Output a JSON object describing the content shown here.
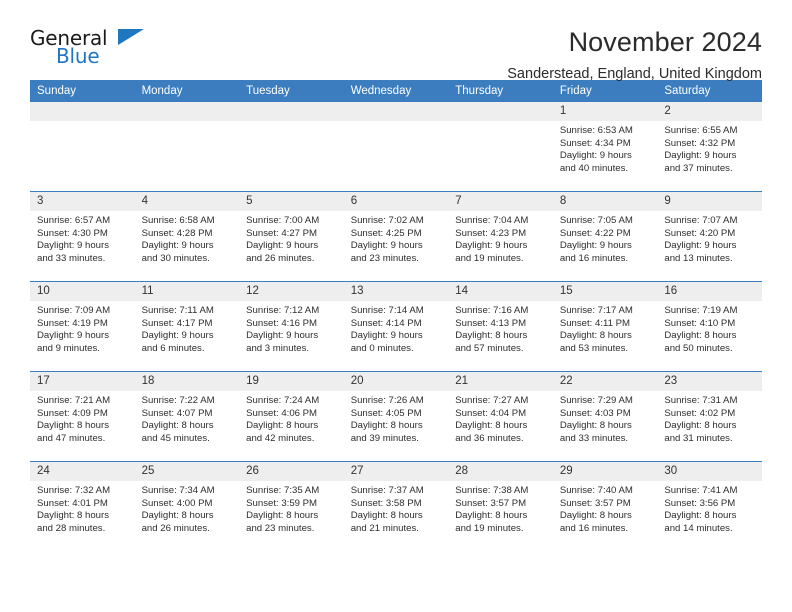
{
  "brand": {
    "name_top": "General",
    "name_bottom": "Blue",
    "accent_color": "#1f77c0"
  },
  "header": {
    "title": "November 2024",
    "location": "Sanderstead, England, United Kingdom"
  },
  "theme": {
    "header_row_color": "#3b7dbf",
    "daynum_bg": "#eeeeee",
    "text_color": "#2e2e2e"
  },
  "labels": {
    "sunrise_prefix": "Sunrise:",
    "sunset_prefix": "Sunset:",
    "daylight_prefix": "Daylight:"
  },
  "columns": [
    "Sunday",
    "Monday",
    "Tuesday",
    "Wednesday",
    "Thursday",
    "Friday",
    "Saturday"
  ],
  "weeks": [
    [
      {
        "day": "",
        "empty": true
      },
      {
        "day": "",
        "empty": true
      },
      {
        "day": "",
        "empty": true
      },
      {
        "day": "",
        "empty": true
      },
      {
        "day": "",
        "empty": true
      },
      {
        "day": "1",
        "sunrise": "Sunrise: 6:53 AM",
        "sunset": "Sunset: 4:34 PM",
        "daylight_1": "Daylight: 9 hours",
        "daylight_2": "and 40 minutes."
      },
      {
        "day": "2",
        "sunrise": "Sunrise: 6:55 AM",
        "sunset": "Sunset: 4:32 PM",
        "daylight_1": "Daylight: 9 hours",
        "daylight_2": "and 37 minutes."
      }
    ],
    [
      {
        "day": "3",
        "sunrise": "Sunrise: 6:57 AM",
        "sunset": "Sunset: 4:30 PM",
        "daylight_1": "Daylight: 9 hours",
        "daylight_2": "and 33 minutes."
      },
      {
        "day": "4",
        "sunrise": "Sunrise: 6:58 AM",
        "sunset": "Sunset: 4:28 PM",
        "daylight_1": "Daylight: 9 hours",
        "daylight_2": "and 30 minutes."
      },
      {
        "day": "5",
        "sunrise": "Sunrise: 7:00 AM",
        "sunset": "Sunset: 4:27 PM",
        "daylight_1": "Daylight: 9 hours",
        "daylight_2": "and 26 minutes."
      },
      {
        "day": "6",
        "sunrise": "Sunrise: 7:02 AM",
        "sunset": "Sunset: 4:25 PM",
        "daylight_1": "Daylight: 9 hours",
        "daylight_2": "and 23 minutes."
      },
      {
        "day": "7",
        "sunrise": "Sunrise: 7:04 AM",
        "sunset": "Sunset: 4:23 PM",
        "daylight_1": "Daylight: 9 hours",
        "daylight_2": "and 19 minutes."
      },
      {
        "day": "8",
        "sunrise": "Sunrise: 7:05 AM",
        "sunset": "Sunset: 4:22 PM",
        "daylight_1": "Daylight: 9 hours",
        "daylight_2": "and 16 minutes."
      },
      {
        "day": "9",
        "sunrise": "Sunrise: 7:07 AM",
        "sunset": "Sunset: 4:20 PM",
        "daylight_1": "Daylight: 9 hours",
        "daylight_2": "and 13 minutes."
      }
    ],
    [
      {
        "day": "10",
        "sunrise": "Sunrise: 7:09 AM",
        "sunset": "Sunset: 4:19 PM",
        "daylight_1": "Daylight: 9 hours",
        "daylight_2": "and 9 minutes."
      },
      {
        "day": "11",
        "sunrise": "Sunrise: 7:11 AM",
        "sunset": "Sunset: 4:17 PM",
        "daylight_1": "Daylight: 9 hours",
        "daylight_2": "and 6 minutes."
      },
      {
        "day": "12",
        "sunrise": "Sunrise: 7:12 AM",
        "sunset": "Sunset: 4:16 PM",
        "daylight_1": "Daylight: 9 hours",
        "daylight_2": "and 3 minutes."
      },
      {
        "day": "13",
        "sunrise": "Sunrise: 7:14 AM",
        "sunset": "Sunset: 4:14 PM",
        "daylight_1": "Daylight: 9 hours",
        "daylight_2": "and 0 minutes."
      },
      {
        "day": "14",
        "sunrise": "Sunrise: 7:16 AM",
        "sunset": "Sunset: 4:13 PM",
        "daylight_1": "Daylight: 8 hours",
        "daylight_2": "and 57 minutes."
      },
      {
        "day": "15",
        "sunrise": "Sunrise: 7:17 AM",
        "sunset": "Sunset: 4:11 PM",
        "daylight_1": "Daylight: 8 hours",
        "daylight_2": "and 53 minutes."
      },
      {
        "day": "16",
        "sunrise": "Sunrise: 7:19 AM",
        "sunset": "Sunset: 4:10 PM",
        "daylight_1": "Daylight: 8 hours",
        "daylight_2": "and 50 minutes."
      }
    ],
    [
      {
        "day": "17",
        "sunrise": "Sunrise: 7:21 AM",
        "sunset": "Sunset: 4:09 PM",
        "daylight_1": "Daylight: 8 hours",
        "daylight_2": "and 47 minutes."
      },
      {
        "day": "18",
        "sunrise": "Sunrise: 7:22 AM",
        "sunset": "Sunset: 4:07 PM",
        "daylight_1": "Daylight: 8 hours",
        "daylight_2": "and 45 minutes."
      },
      {
        "day": "19",
        "sunrise": "Sunrise: 7:24 AM",
        "sunset": "Sunset: 4:06 PM",
        "daylight_1": "Daylight: 8 hours",
        "daylight_2": "and 42 minutes."
      },
      {
        "day": "20",
        "sunrise": "Sunrise: 7:26 AM",
        "sunset": "Sunset: 4:05 PM",
        "daylight_1": "Daylight: 8 hours",
        "daylight_2": "and 39 minutes."
      },
      {
        "day": "21",
        "sunrise": "Sunrise: 7:27 AM",
        "sunset": "Sunset: 4:04 PM",
        "daylight_1": "Daylight: 8 hours",
        "daylight_2": "and 36 minutes."
      },
      {
        "day": "22",
        "sunrise": "Sunrise: 7:29 AM",
        "sunset": "Sunset: 4:03 PM",
        "daylight_1": "Daylight: 8 hours",
        "daylight_2": "and 33 minutes."
      },
      {
        "day": "23",
        "sunrise": "Sunrise: 7:31 AM",
        "sunset": "Sunset: 4:02 PM",
        "daylight_1": "Daylight: 8 hours",
        "daylight_2": "and 31 minutes."
      }
    ],
    [
      {
        "day": "24",
        "sunrise": "Sunrise: 7:32 AM",
        "sunset": "Sunset: 4:01 PM",
        "daylight_1": "Daylight: 8 hours",
        "daylight_2": "and 28 minutes."
      },
      {
        "day": "25",
        "sunrise": "Sunrise: 7:34 AM",
        "sunset": "Sunset: 4:00 PM",
        "daylight_1": "Daylight: 8 hours",
        "daylight_2": "and 26 minutes."
      },
      {
        "day": "26",
        "sunrise": "Sunrise: 7:35 AM",
        "sunset": "Sunset: 3:59 PM",
        "daylight_1": "Daylight: 8 hours",
        "daylight_2": "and 23 minutes."
      },
      {
        "day": "27",
        "sunrise": "Sunrise: 7:37 AM",
        "sunset": "Sunset: 3:58 PM",
        "daylight_1": "Daylight: 8 hours",
        "daylight_2": "and 21 minutes."
      },
      {
        "day": "28",
        "sunrise": "Sunrise: 7:38 AM",
        "sunset": "Sunset: 3:57 PM",
        "daylight_1": "Daylight: 8 hours",
        "daylight_2": "and 19 minutes."
      },
      {
        "day": "29",
        "sunrise": "Sunrise: 7:40 AM",
        "sunset": "Sunset: 3:57 PM",
        "daylight_1": "Daylight: 8 hours",
        "daylight_2": "and 16 minutes."
      },
      {
        "day": "30",
        "sunrise": "Sunrise: 7:41 AM",
        "sunset": "Sunset: 3:56 PM",
        "daylight_1": "Daylight: 8 hours",
        "daylight_2": "and 14 minutes."
      }
    ]
  ]
}
